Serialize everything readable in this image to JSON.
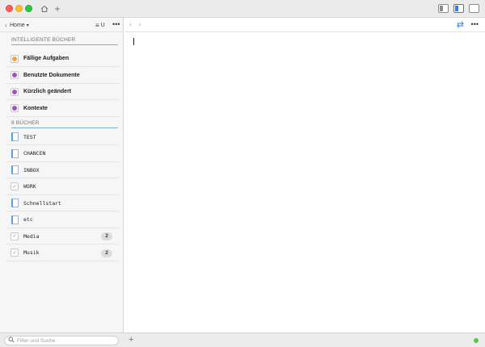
{
  "toolbar": {
    "home_label": "Home",
    "sort_label": "U"
  },
  "sidebar": {
    "smart_section": "INTELLIGENTE BÜCHER",
    "smart_items": [
      {
        "label": "Fällige Aufgaben",
        "color": "#f0a24a"
      },
      {
        "label": "Benutzte Dokumente",
        "color": "#9b59b6"
      },
      {
        "label": "Kürzlich geändert",
        "color": "#9b59b6"
      },
      {
        "label": "Kontexte",
        "color": "#9b59b6"
      }
    ],
    "books_section": "8 BÜCHER",
    "books": [
      {
        "label": "TEST",
        "icon": "book-icon",
        "badge": ""
      },
      {
        "label": "CHANCEN",
        "icon": "book-icon",
        "badge": ""
      },
      {
        "label": "INBOX",
        "icon": "book-icon",
        "badge": ""
      },
      {
        "label": "WORK",
        "icon": "check-icon",
        "badge": ""
      },
      {
        "label": "Schnellstart",
        "icon": "book-icon",
        "badge": ""
      },
      {
        "label": "etc",
        "icon": "book-icon",
        "badge": ""
      },
      {
        "label": "Media",
        "icon": "check-icon",
        "badge": "2"
      },
      {
        "label": "Musik",
        "icon": "check-icon",
        "badge": "2"
      }
    ]
  },
  "bottom": {
    "filter_placeholder": "Filter und Suche"
  },
  "colors": {
    "accent": "#2f7cf6",
    "status": "#5fc24f"
  }
}
